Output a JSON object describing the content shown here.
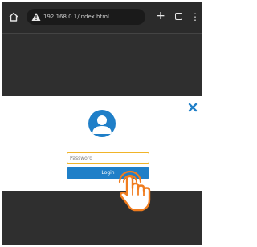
{
  "browser": {
    "url": "192.168.0.1/index.html",
    "new_tab_label": "+",
    "menu_label": "⋮",
    "icons": [
      "home-icon",
      "warning-icon",
      "plus-icon",
      "tabs-icon",
      "menu-icon"
    ]
  },
  "dialog": {
    "password_placeholder": "Password",
    "login_label": "Login",
    "close_label": "✕",
    "accent_color": "#1f7fc8",
    "focus_border_color": "#f0b429",
    "icons": [
      "user-avatar-icon",
      "close-icon",
      "tap-hand-icon"
    ]
  }
}
